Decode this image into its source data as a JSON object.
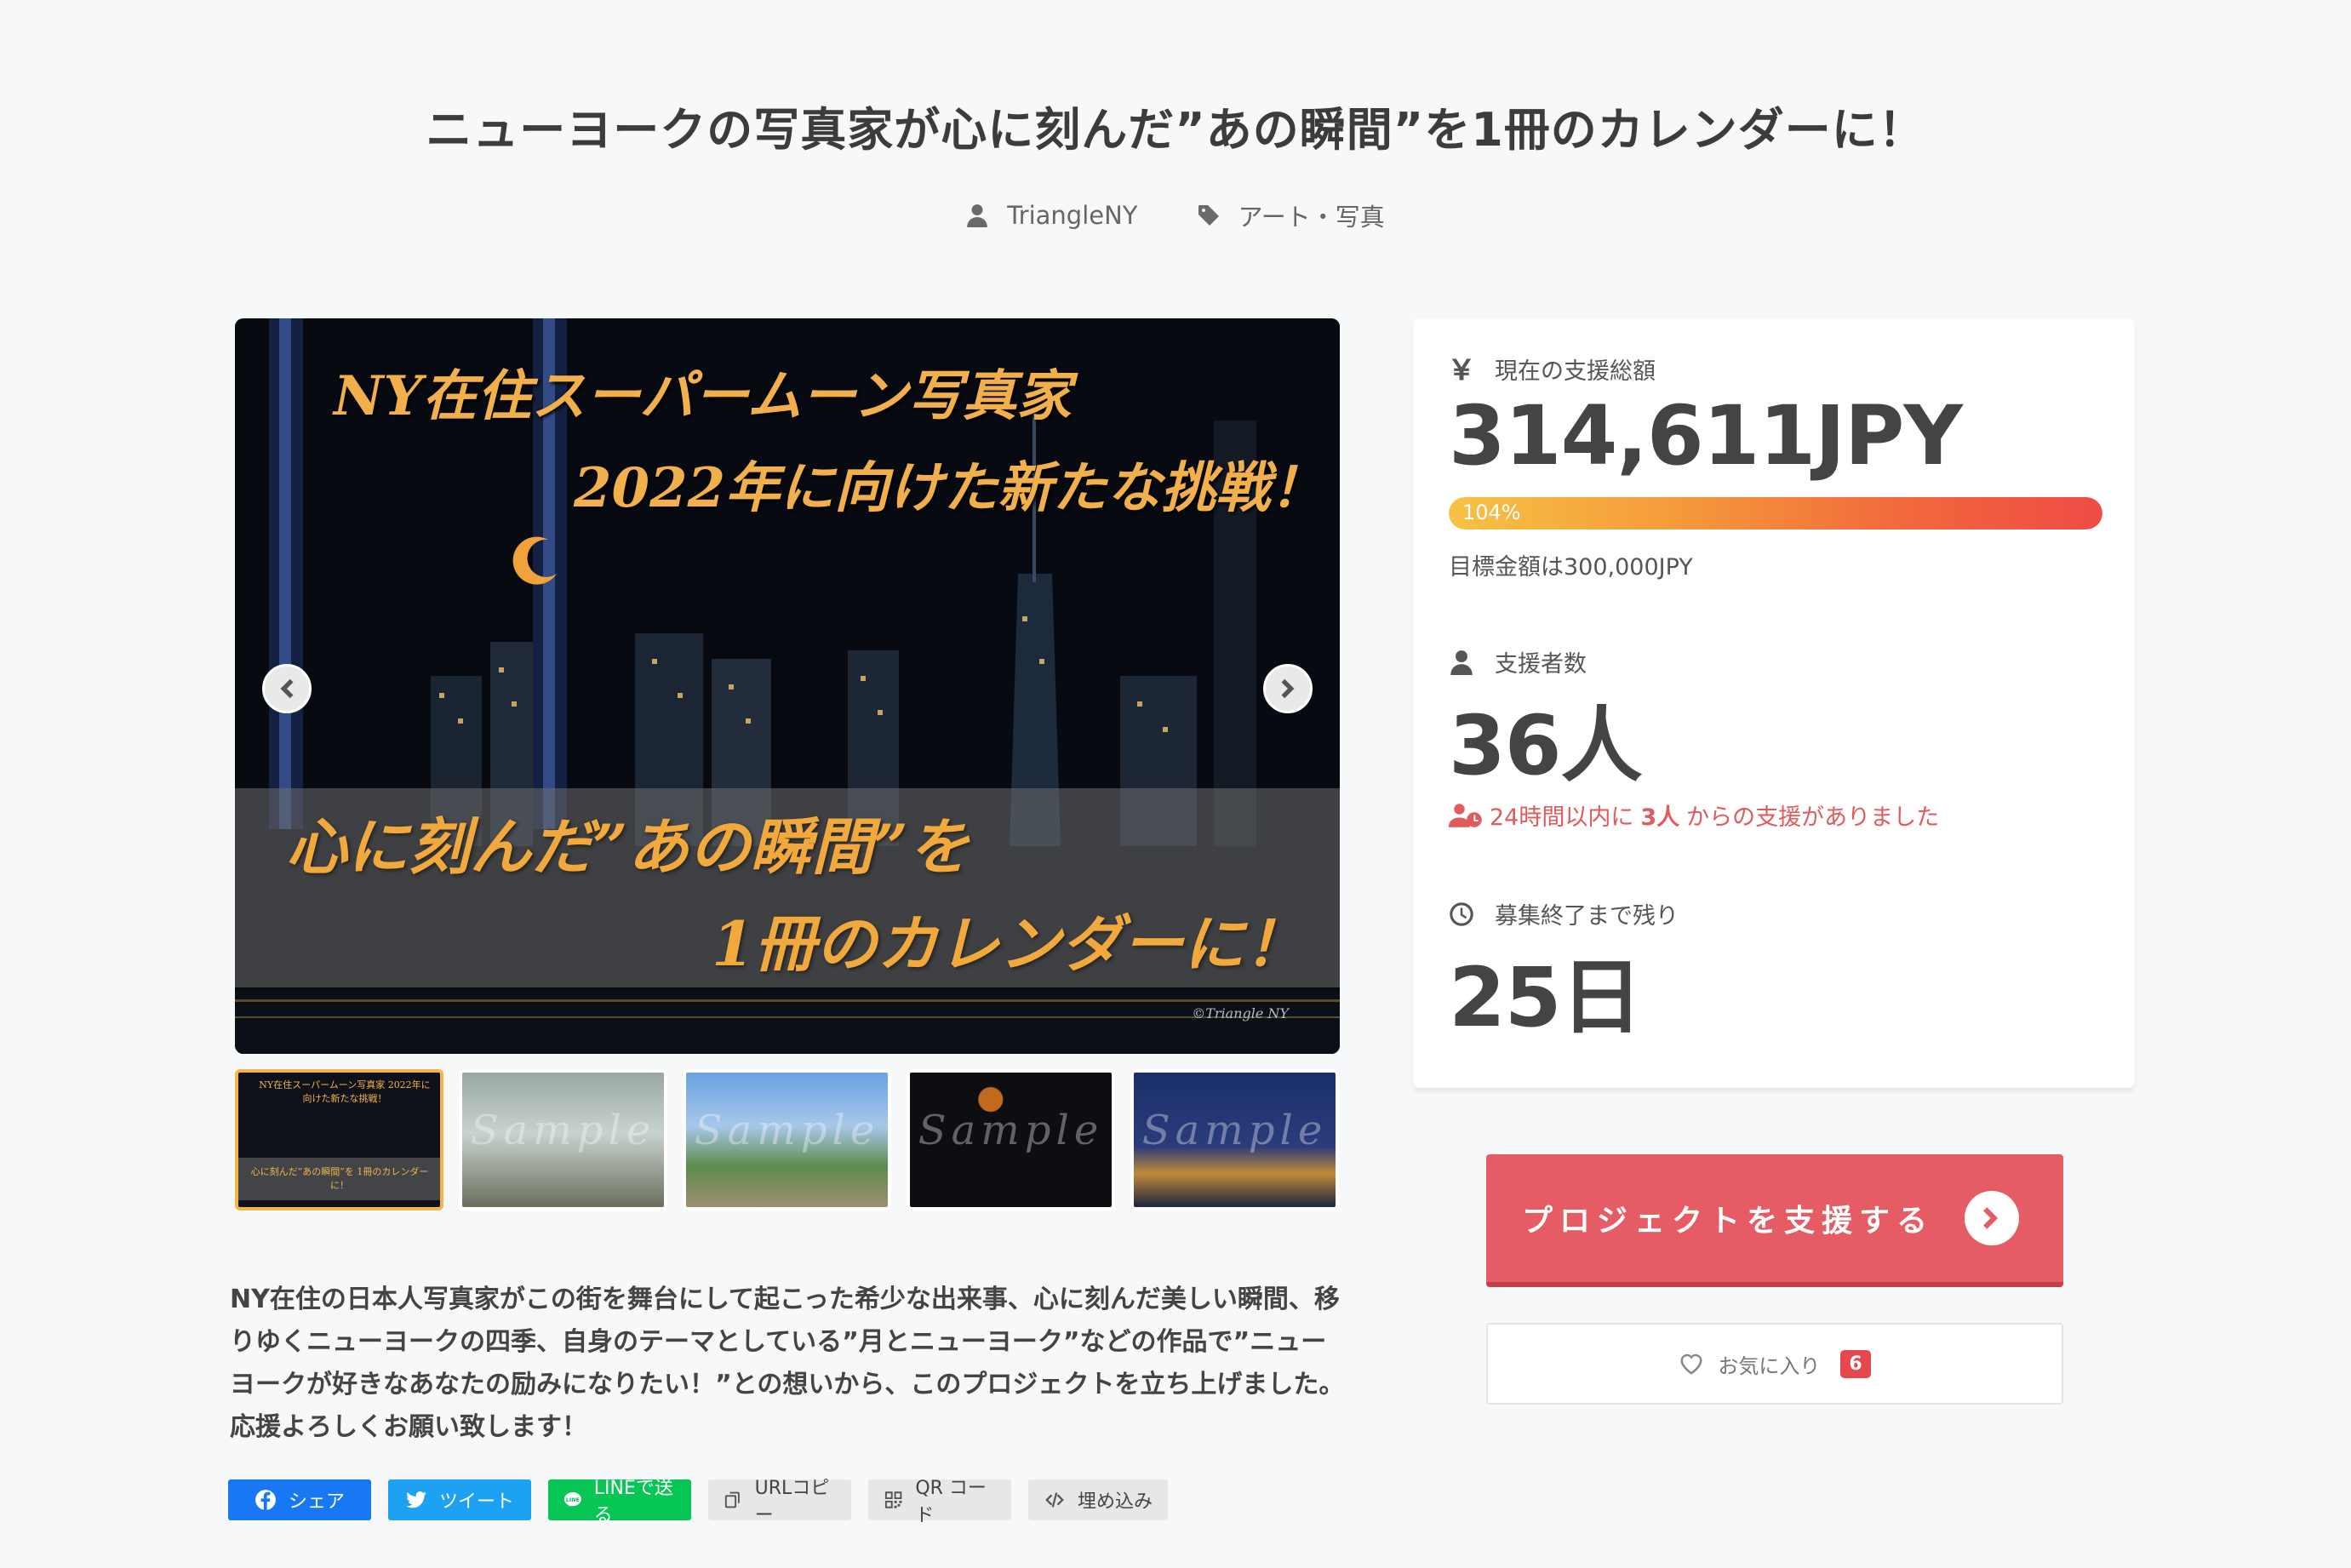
{
  "page": {
    "title": "ニューヨークの写真家が心に刻んだ”あの瞬間”を1冊のカレンダーに！",
    "author": "TriangleNY",
    "category": "アート・写真"
  },
  "hero": {
    "heading_line1": "NY在住スーパームーン写真家",
    "heading_line2": "2022年に向けた新たな挑戦！",
    "caption_line1": "心に刻んだ”あの瞬間”を",
    "caption_line2": "1冊のカレンダーに！",
    "credit": "©Triangle NY"
  },
  "thumbnails": [
    {
      "label": "NY在住スーパームーン写真家 2022年に向けた新たな挑戦！",
      "sub": "心に刻んだ”あの瞬間”を 1冊のカレンダーに！",
      "watermark": ""
    },
    {
      "label": "",
      "sub": "",
      "watermark": "Sample"
    },
    {
      "label": "",
      "sub": "",
      "watermark": "Sample"
    },
    {
      "label": "",
      "sub": "",
      "watermark": "Sample"
    },
    {
      "label": "",
      "sub": "",
      "watermark": "Sample"
    }
  ],
  "description": "NY在住の日本人写真家がこの街を舞台にして起こった希少な出来事、心に刻んだ美しい瞬間、移りゆくニューヨークの四季、自身のテーマとしている”月とニューヨーク”などの作品で”ニューヨークが好きなあなたの励みになりたい！”との想いから、このプロジェクトを立ち上げました。応援よろしくお願い致します！",
  "share": {
    "facebook": "シェア",
    "twitter": "ツイート",
    "line": "LINEで送る",
    "url_copy": "URLコピー",
    "qr": "QR コード",
    "embed": "埋め込み"
  },
  "stats": {
    "total_label": "現在の支援総額",
    "total_value": "314,611JPY",
    "progress_percent": 104,
    "progress_label": "104%",
    "goal_text": "目標金額は300,000JPY",
    "backers_label": "支援者数",
    "backers_value": "36人",
    "recent_prefix": "24時間以内に",
    "recent_count": "3人",
    "recent_suffix": "からの支援がありました",
    "remaining_label": "募集終了まで残り",
    "remaining_value": "25日"
  },
  "actions": {
    "support_label": "プロジェクトを支援する",
    "favorite_label": "お気に入り",
    "favorite_count": "6"
  },
  "colors": {
    "accent": "#e65c64",
    "progress_start": "#f7c244",
    "progress_end": "#ef4b45",
    "facebook": "#1877f2",
    "twitter": "#1da1f2",
    "line": "#06c755"
  }
}
